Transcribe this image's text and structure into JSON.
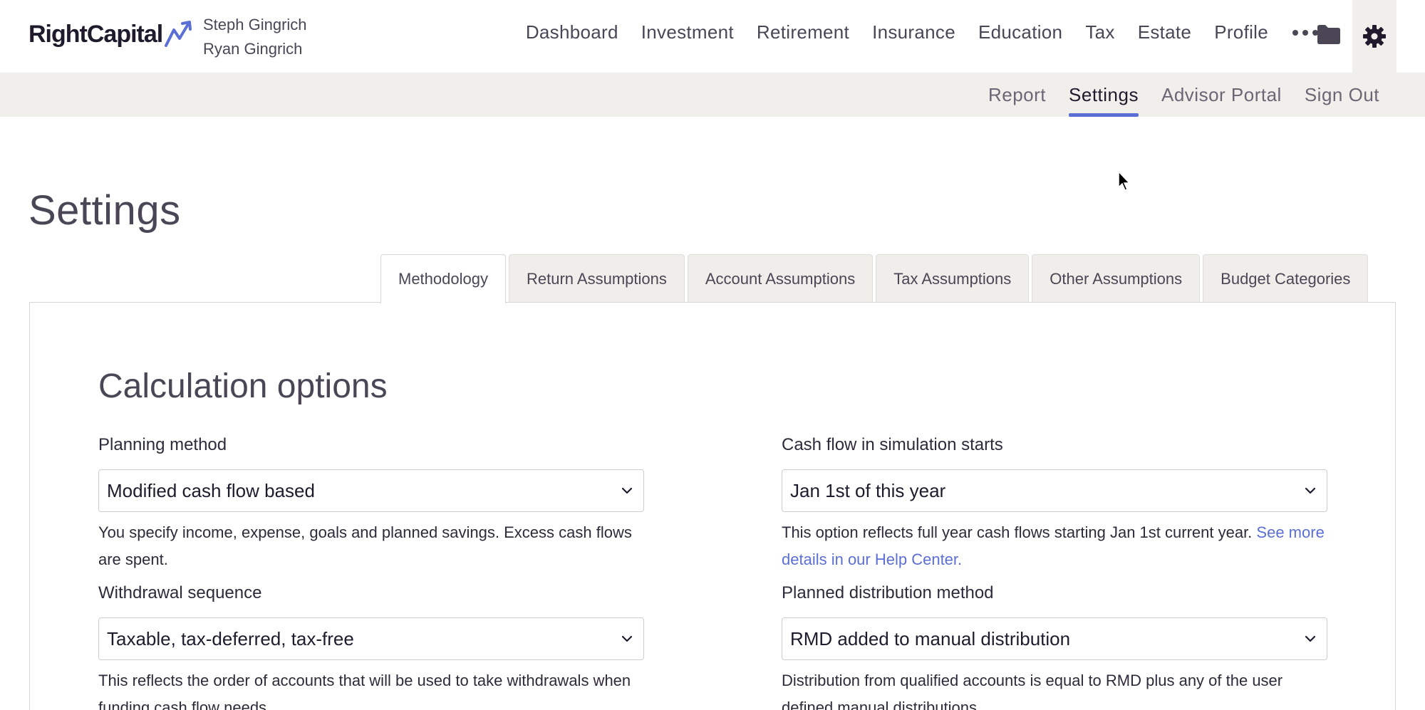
{
  "brand": {
    "logo_text": "RightCapital"
  },
  "clients": [
    "Steph Gingrich",
    "Ryan Gingrich"
  ],
  "main_nav": [
    "Dashboard",
    "Investment",
    "Retirement",
    "Insurance",
    "Education",
    "Tax",
    "Estate",
    "Profile"
  ],
  "icons": {
    "more": "more-icon",
    "folder": "folder-icon",
    "settings": "gear-icon"
  },
  "sub_nav": {
    "report": "Report",
    "settings": "Settings",
    "advisor_portal": "Advisor Portal",
    "sign_out": "Sign Out"
  },
  "page": {
    "title": "Settings"
  },
  "tabs": [
    {
      "label": "Methodology",
      "active": true
    },
    {
      "label": "Return Assumptions",
      "active": false
    },
    {
      "label": "Account Assumptions",
      "active": false
    },
    {
      "label": "Tax Assumptions",
      "active": false
    },
    {
      "label": "Other Assumptions",
      "active": false
    },
    {
      "label": "Budget Categories",
      "active": false
    }
  ],
  "section": {
    "title": "Calculation options",
    "planning_method": {
      "label": "Planning method",
      "value": "Modified cash flow based",
      "help": "You specify income, expense, goals and planned savings. Excess cash flows are spent."
    },
    "cash_flow_start": {
      "label": "Cash flow in simulation starts",
      "value": "Jan 1st of this year",
      "help": "This option reflects full year cash flows starting Jan 1st current year.",
      "help_link": "See more details in our Help Center."
    },
    "withdrawal_sequence": {
      "label": "Withdrawal sequence",
      "value": "Taxable, tax-deferred, tax-free",
      "help": "This reflects the order of accounts that will be used to take withdrawals when funding cash flow needs."
    },
    "planned_distribution": {
      "label": "Planned distribution method",
      "value": "RMD added to manual distribution",
      "help": "Distribution from qualified accounts is equal to RMD plus any of the user defined manual distributions."
    }
  },
  "colors": {
    "accent": "#5b6fd6",
    "subbar_bg": "#f0efeb",
    "text": "#4a4656"
  }
}
